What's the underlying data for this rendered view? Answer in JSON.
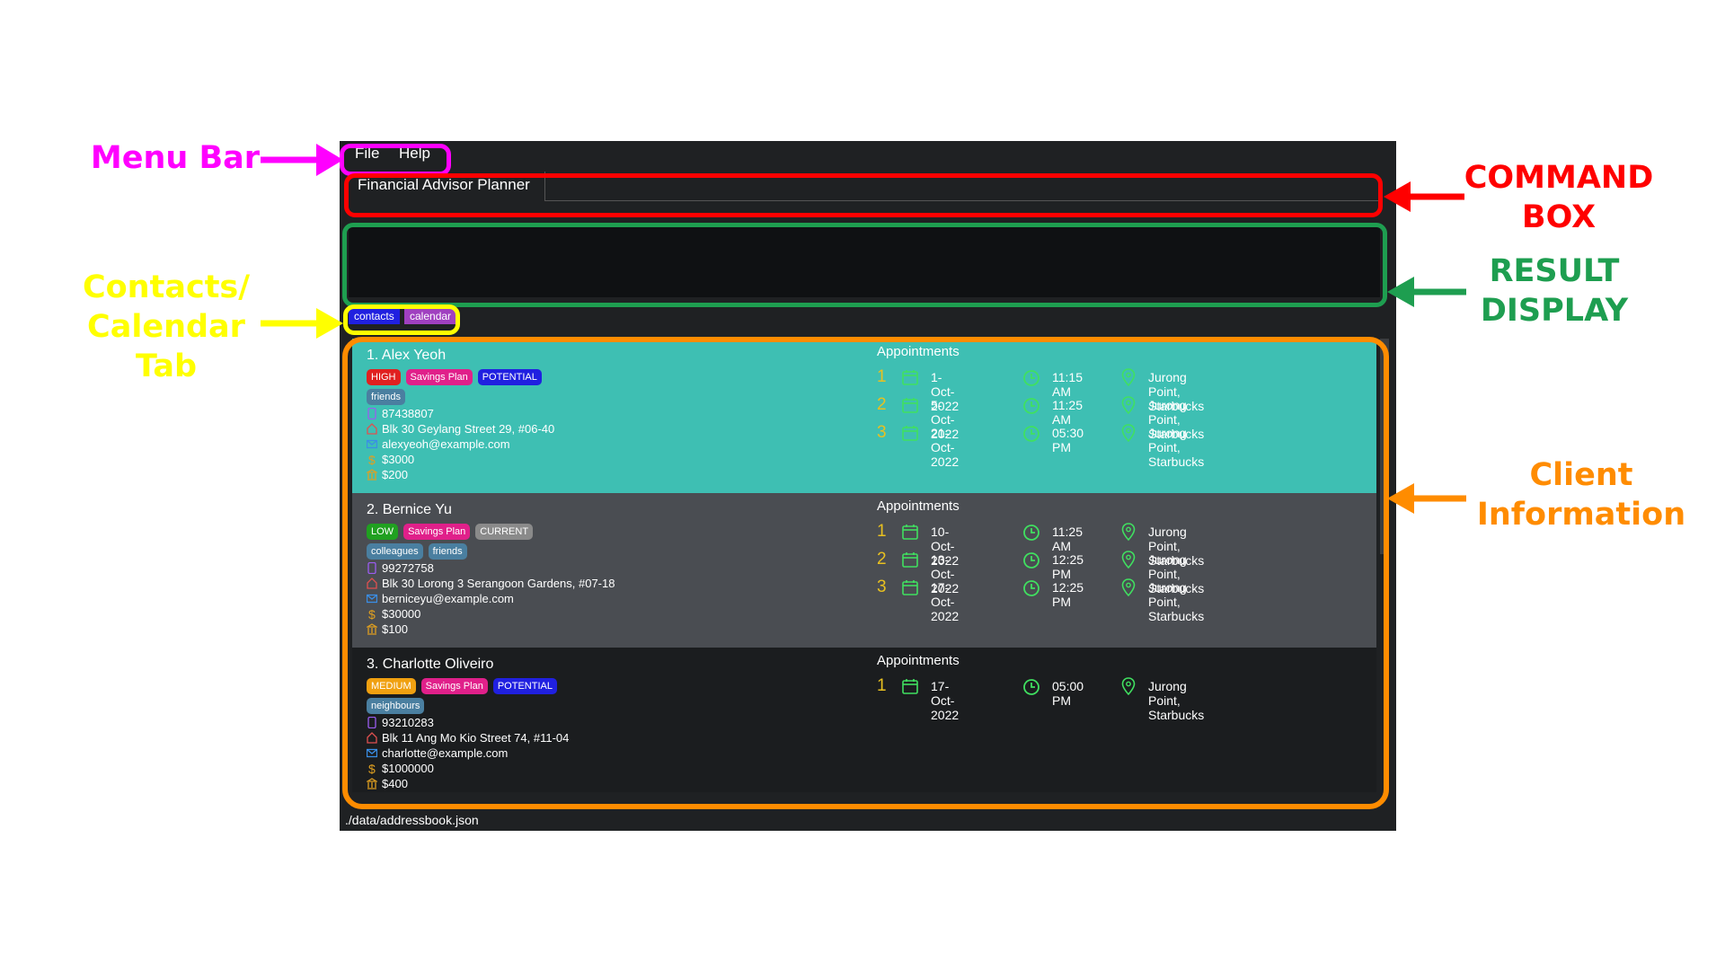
{
  "menu": {
    "file": "File",
    "help": "Help"
  },
  "command": {
    "title": "Financial Advisor Planner",
    "value": ""
  },
  "tabs": [
    {
      "label": "contacts",
      "color": "#2020e0"
    },
    {
      "label": "calendar",
      "color": "#a040c0"
    }
  ],
  "clients": [
    {
      "name": "1.  Alex Yeoh",
      "background": "#3ebfb3",
      "tags": [
        {
          "label": "HIGH",
          "color": "#e02020"
        },
        {
          "label": "Savings Plan",
          "color": "#e0208a"
        },
        {
          "label": "POTENTIAL",
          "color": "#2020e0"
        }
      ],
      "groups": [
        "friends"
      ],
      "phone": "87438807",
      "address": "Blk 30 Geylang Street 29, #06-40",
      "email": "alexyeoh@example.com",
      "income": "$3000",
      "monthly": "$200",
      "appointments_title": "Appointments",
      "appointments": [
        {
          "idx": "1",
          "date": "1-Oct-2022",
          "time": "11:15 AM",
          "location": "Jurong Point, Starbucks"
        },
        {
          "idx": "2",
          "date": "5-Oct-2022",
          "time": "11:25 AM",
          "location": "Jurong Point, Starbucks"
        },
        {
          "idx": "3",
          "date": "21-Oct-2022",
          "time": "05:30 PM",
          "location": "Jurong Point, Starbucks"
        }
      ]
    },
    {
      "name": "2.  Bernice Yu",
      "background": "#4a4d52",
      "tags": [
        {
          "label": "LOW",
          "color": "#20a020"
        },
        {
          "label": "Savings Plan",
          "color": "#e0208a"
        },
        {
          "label": "CURRENT",
          "color": "#8a8a8a"
        }
      ],
      "groups": [
        "colleagues",
        "friends"
      ],
      "phone": "99272758",
      "address": "Blk 30 Lorong 3 Serangoon Gardens, #07-18",
      "email": "berniceyu@example.com",
      "income": "$30000",
      "monthly": "$100",
      "appointments_title": "Appointments",
      "appointments": [
        {
          "idx": "1",
          "date": "10-Oct-2022",
          "time": "11:25 AM",
          "location": "Jurong Point, Starbucks"
        },
        {
          "idx": "2",
          "date": "13-Oct-2022",
          "time": "12:25 PM",
          "location": "Jurong Point, Starbucks"
        },
        {
          "idx": "3",
          "date": "17-Oct-2022",
          "time": "12:25 PM",
          "location": "Jurong Point, Starbucks"
        }
      ]
    },
    {
      "name": "3.  Charlotte Oliveiro",
      "background": "#1b1d1f",
      "tags": [
        {
          "label": "MEDIUM",
          "color": "#f0a010"
        },
        {
          "label": "Savings Plan",
          "color": "#e0208a"
        },
        {
          "label": "POTENTIAL",
          "color": "#2020e0"
        }
      ],
      "groups": [
        "neighbours"
      ],
      "phone": "93210283",
      "address": "Blk 11 Ang Mo Kio Street 74, #11-04",
      "email": "charlotte@example.com",
      "income": "$1000000",
      "monthly": "$400",
      "appointments_title": "Appointments",
      "appointments": [
        {
          "idx": "1",
          "date": "17-Oct-2022",
          "time": "05:00 PM",
          "location": "Jurong Point, Starbucks"
        }
      ]
    }
  ],
  "status": "./data/addressbook.json",
  "annotations": {
    "menu_bar": "Menu Bar",
    "command_box_1": "COMMAND",
    "command_box_2": "BOX",
    "result_1": "RESULT",
    "result_2": "DISPLAY",
    "tab_1": "Contacts/",
    "tab_2": "Calendar",
    "tab_3": "Tab",
    "client_1": "Client",
    "client_2": "Information"
  },
  "colors": {
    "menu": "#ff00ff",
    "command": "#ff0000",
    "result": "#1e9e50",
    "tab": "#ffff00",
    "client": "#ff8c00",
    "icon_green": "#40e060",
    "index_yellow": "#e8c020"
  }
}
